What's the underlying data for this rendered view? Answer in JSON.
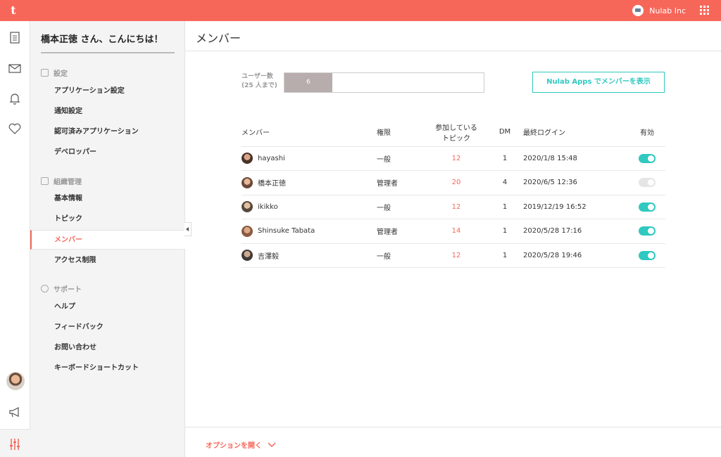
{
  "topbar": {
    "logo": "t",
    "org_name": "Nulab Inc",
    "color": "#f6675a"
  },
  "sidebar": {
    "greeting": "橋本正徳 さん、こんにちは！",
    "sections": [
      {
        "title": "設定",
        "icon": "sliders-icon",
        "items": [
          "アプリケーション設定",
          "通知設定",
          "認可済みアプリケーション",
          "デベロッパー"
        ]
      },
      {
        "title": "組織管理",
        "icon": "briefcase-icon",
        "items": [
          "基本情報",
          "トピック",
          "メンバー",
          "アクセス制限"
        ]
      },
      {
        "title": "サポート",
        "icon": "smile-icon",
        "items": [
          "ヘルプ",
          "フィードバック",
          "お問い合わせ",
          "キーボードショートカット"
        ]
      }
    ],
    "active_item": "メンバー"
  },
  "main": {
    "title": "メンバー",
    "user_count_label": "ユーザー数",
    "user_count_limit": "(25 人まで)",
    "user_count_value": "6",
    "user_count_fraction": 0.24,
    "nulab_apps_button": "Nulab Apps でメンバーを表示",
    "table": {
      "headers": {
        "member": "メンバー",
        "role": "権限",
        "topics_1": "参加している",
        "topics_2": "トピック",
        "dm": "DM",
        "last_login": "最終ログイン",
        "enabled": "有効"
      },
      "rows": [
        {
          "name": "hayashi",
          "role": "一般",
          "topics": "12",
          "dm": "1",
          "last_login": "2020/1/8 15:48",
          "enabled": true
        },
        {
          "name": "橋本正徳",
          "role": "管理者",
          "topics": "20",
          "dm": "4",
          "last_login": "2020/6/5 12:36",
          "enabled": false
        },
        {
          "name": "ikikko",
          "role": "一般",
          "topics": "12",
          "dm": "1",
          "last_login": "2019/12/19 16:52",
          "enabled": true
        },
        {
          "name": "Shinsuke Tabata",
          "role": "管理者",
          "topics": "14",
          "dm": "1",
          "last_login": "2020/5/28 17:16",
          "enabled": true
        },
        {
          "name": "吉澤毅",
          "role": "一般",
          "topics": "12",
          "dm": "1",
          "last_login": "2020/5/28 19:46",
          "enabled": true
        }
      ]
    },
    "footer_option": "オプションを開く"
  },
  "colors": {
    "accent": "#f6675a",
    "teal": "#2fc9c0"
  }
}
